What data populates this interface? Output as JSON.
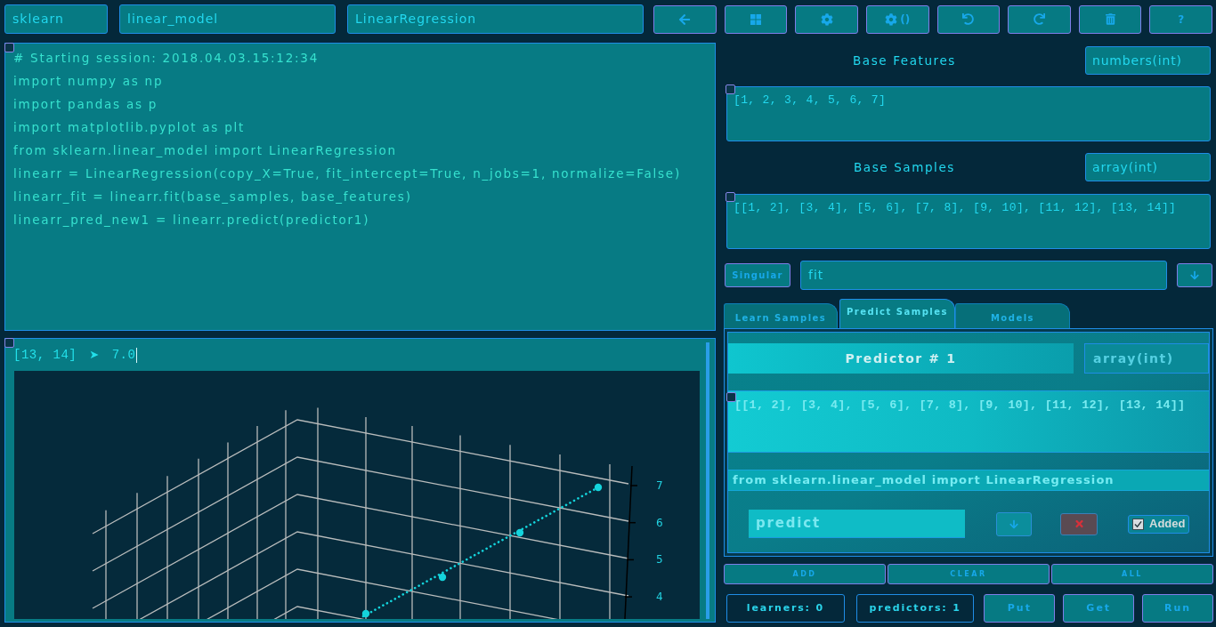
{
  "toolbar": {
    "fields": [
      {
        "value": "sklearn"
      },
      {
        "value": "linear_model"
      },
      {
        "value": "LinearRegression"
      }
    ],
    "buttons": [
      {
        "kind": "back"
      },
      {
        "kind": "grid"
      },
      {
        "kind": "gear"
      },
      {
        "kind": "gear",
        "label": "()"
      },
      {
        "kind": "undo"
      },
      {
        "kind": "redo"
      },
      {
        "kind": "trash"
      },
      {
        "kind": "text",
        "label": "?"
      }
    ]
  },
  "session_log": {
    "lines": [
      "# Starting session: 2018.04.03.15:12:34",
      "import numpy as np",
      "import pandas as p",
      "import matplotlib.pyplot as plt",
      "from sklearn.linear_model import LinearRegression",
      "linearr = LinearRegression(copy_X=True, fit_intercept=True, n_jobs=1, normalize=False)",
      "linearr_fit = linearr.fit(base_samples, base_features)",
      "linearr_pred_new1 = linearr.predict(predictor1)"
    ]
  },
  "output": {
    "query": "[13, 14]",
    "arrow": "➤",
    "result": "7.0",
    "plot": {
      "z_tick_labels": [
        "7",
        "6",
        "5",
        "4"
      ]
    }
  },
  "base_features": {
    "label": "Base Features",
    "type": "numbers(int)",
    "value": "[1, 2, 3, 4, 5, 6, 7]"
  },
  "base_samples": {
    "label": "Base Samples",
    "type": "array(int)",
    "value": "[[1, 2], [3, 4], [5, 6], [7, 8], [9, 10], [11, 12], [13, 14]]"
  },
  "method_row": {
    "mode_button": "Singular",
    "method": "fit"
  },
  "tabs": [
    {
      "label": "Learn Samples",
      "selected": false
    },
    {
      "label": "Predict Samples",
      "selected": true
    },
    {
      "label": "Models",
      "selected": false
    }
  ],
  "predictor": {
    "title": "Predictor # 1",
    "type": "array(int)",
    "value": "[[1, 2], [3, 4], [5, 6], [7, 8], [9, 10], [11, 12], [13, 14]]",
    "import_line": "from sklearn.linear_model import LinearRegression",
    "method": "predict",
    "added": true,
    "added_label": "Added"
  },
  "actions": [
    "ADD",
    "CLEAR",
    "ALL"
  ],
  "counters": [
    "learners: 0",
    "predictors: 1"
  ],
  "run_buttons": [
    "Put",
    "Get",
    "Run"
  ]
}
